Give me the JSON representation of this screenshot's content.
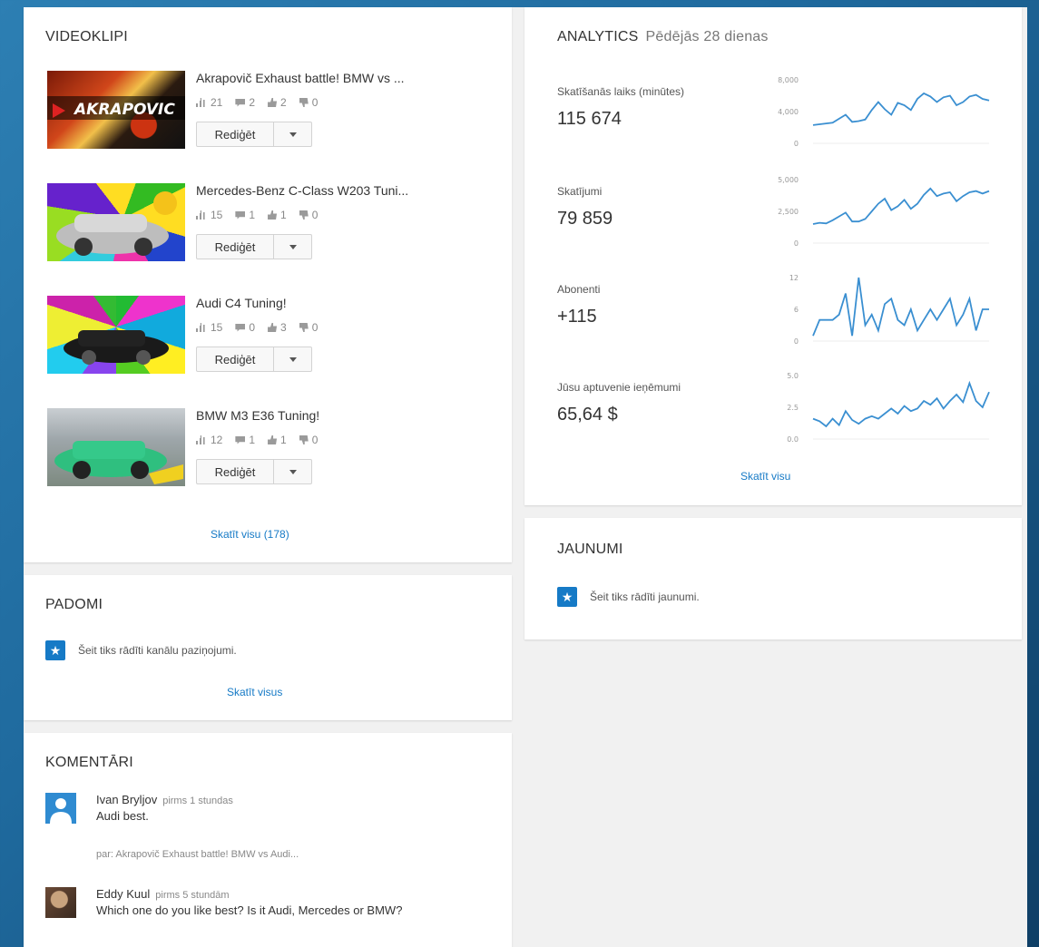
{
  "videos": {
    "title": "VIDEOKLIPI",
    "edit_label": "Rediģēt",
    "see_all": "Skatīt visu (178)",
    "items": [
      {
        "title": "Akrapovič Exhaust battle! BMW vs ...",
        "views": "21",
        "comments": "2",
        "likes": "2",
        "dislikes": "0",
        "thumb_logo": "AKRAPOVIC"
      },
      {
        "title": "Mercedes-Benz C-Class W203 Tuni...",
        "views": "15",
        "comments": "1",
        "likes": "1",
        "dislikes": "0",
        "thumb_logo": ""
      },
      {
        "title": "Audi C4 Tuning!",
        "views": "15",
        "comments": "0",
        "likes": "3",
        "dislikes": "0",
        "thumb_logo": ""
      },
      {
        "title": "BMW M3 E36 Tuning!",
        "views": "12",
        "comments": "1",
        "likes": "1",
        "dislikes": "0",
        "thumb_logo": ""
      }
    ]
  },
  "tips": {
    "title": "PADOMI",
    "message": "Šeit tiks rādīti kanālu paziņojumi.",
    "see_all": "Skatīt visus"
  },
  "comments": {
    "title": "KOMENTĀRI",
    "items": [
      {
        "author": "Ivan Bryljov",
        "time": "pirms 1 stundas",
        "text": "Audi best.",
        "ref": "par: Akrapovič Exhaust battle! BMW vs Audi..."
      },
      {
        "author": "Eddy Kuul",
        "time": "pirms 5 stundām",
        "text": "Which one do you like best? Is it Audi, Mercedes or BMW?",
        "ref": ""
      }
    ]
  },
  "analytics": {
    "title": "ANALYTICS",
    "period": "Pēdējās 28 dienas",
    "see_all": "Skatīt visu",
    "accent": "#3a8fd1",
    "metrics": [
      {
        "label": "Skatīšanās laiks (minūtes)",
        "value": "115 674",
        "ticks": [
          "8,000",
          "4,000",
          "0"
        ],
        "max": 8000,
        "series": [
          2300,
          2400,
          2500,
          2600,
          3100,
          3600,
          2700,
          2800,
          3000,
          4200,
          5200,
          4300,
          3600,
          5100,
          4800,
          4200,
          5600,
          6300,
          5900,
          5200,
          5800,
          6000,
          4800,
          5200,
          5900,
          6100,
          5600,
          5400
        ]
      },
      {
        "label": "Skatījumi",
        "value": "79 859",
        "ticks": [
          "5,000",
          "2,500",
          "0"
        ],
        "max": 5000,
        "series": [
          1500,
          1600,
          1550,
          1800,
          2100,
          2400,
          1700,
          1700,
          1900,
          2500,
          3100,
          3500,
          2600,
          2900,
          3400,
          2700,
          3100,
          3800,
          4300,
          3700,
          3900,
          4000,
          3300,
          3700,
          4000,
          4100,
          3900,
          4100
        ]
      },
      {
        "label": "Abonenti",
        "value": "+115",
        "ticks": [
          "12",
          "6",
          "0"
        ],
        "max": 12,
        "series": [
          1,
          4,
          4,
          4,
          5,
          9,
          1,
          12,
          3,
          5,
          2,
          7,
          8,
          4,
          3,
          6,
          2,
          4,
          6,
          4,
          6,
          8,
          3,
          5,
          8,
          2,
          6,
          6
        ]
      },
      {
        "label": "Jūsu aptuvenie ieņēmumi",
        "value": "65,64 $",
        "ticks": [
          "5.0",
          "2.5",
          "0.0"
        ],
        "max": 5,
        "series": [
          1.6,
          1.4,
          1.0,
          1.6,
          1.1,
          2.2,
          1.5,
          1.2,
          1.6,
          1.8,
          1.6,
          2.0,
          2.4,
          2.0,
          2.6,
          2.2,
          2.4,
          3.0,
          2.7,
          3.2,
          2.4,
          3.0,
          3.5,
          2.9,
          4.4,
          3.0,
          2.5,
          3.7
        ]
      }
    ]
  },
  "news": {
    "title": "JAUNUMI",
    "message": "Šeit tiks rādīti jaunumi."
  }
}
